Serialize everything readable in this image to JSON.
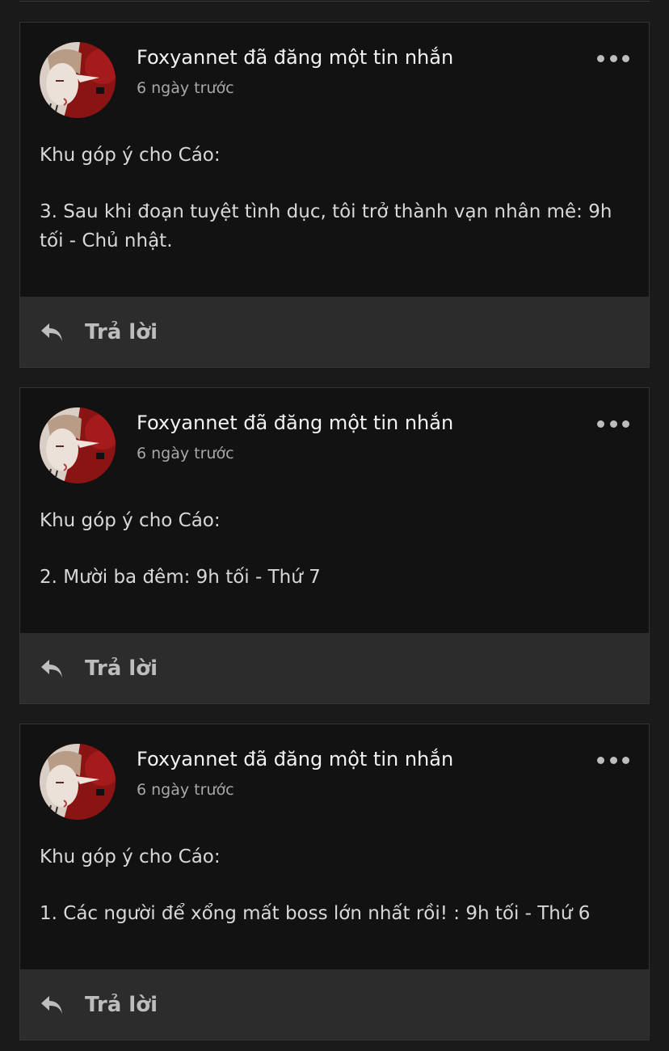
{
  "posts": [
    {
      "author_action": "Foxyannet đã đăng một tin nhắn",
      "time": "6 ngày trước",
      "line1": "Khu góp ý cho Cáo:",
      "line2": "3. Sau khi đoạn tuyệt tình dục, tôi trở thành vạn nhân mê: 9h tối - Chủ nhật.",
      "reply_label": "Trả lời"
    },
    {
      "author_action": "Foxyannet đã đăng một tin nhắn",
      "time": "6 ngày trước",
      "line1": "Khu góp ý cho Cáo:",
      "line2": "2. Mười ba đêm: 9h tối - Thứ 7",
      "reply_label": "Trả lời"
    },
    {
      "author_action": "Foxyannet đã đăng một tin nhắn",
      "time": "6 ngày trước",
      "line1": "Khu góp ý cho Cáo:",
      "line2": "1. Các người để xổng mất boss lớn nhất rồi! : 9h tối - Thứ 6",
      "reply_label": "Trả lời"
    }
  ],
  "icons": {
    "more": "more-horizontal-icon",
    "reply": "reply-arrow-icon",
    "avatar": "user-avatar"
  },
  "colors": {
    "page_bg": "#1a1a1a",
    "card_bg": "#121212",
    "reply_bar_bg": "#2c2c2c",
    "title_text": "#f2f2f2",
    "muted_text": "#a8a8a8"
  }
}
